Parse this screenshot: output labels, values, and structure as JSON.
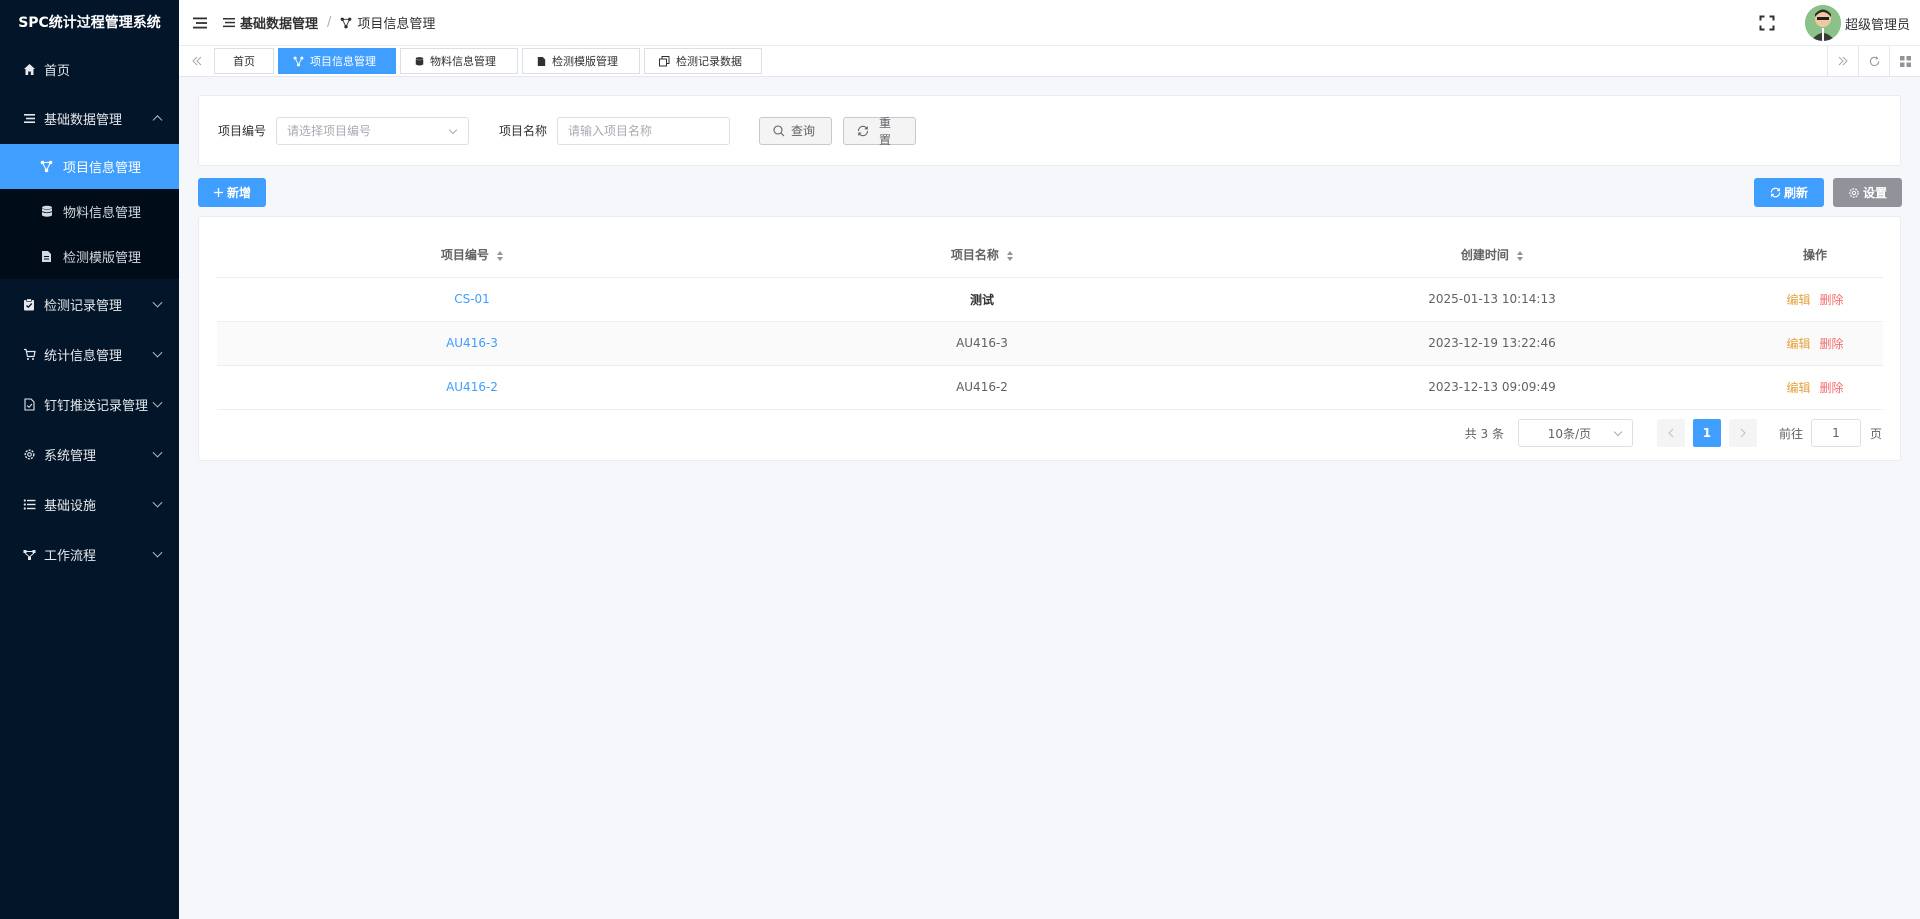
{
  "app": {
    "title": "SPC统计过程管理系统"
  },
  "sidebar": {
    "items": [
      {
        "label": "首页",
        "icon": "home-icon"
      },
      {
        "label": "基础数据管理",
        "icon": "list-icon",
        "expanded": true,
        "children": [
          {
            "label": "项目信息管理",
            "icon": "network-icon",
            "active": true
          },
          {
            "label": "物料信息管理",
            "icon": "database-icon"
          },
          {
            "label": "检测模版管理",
            "icon": "document-icon"
          }
        ]
      },
      {
        "label": "检测记录管理",
        "icon": "clipboard-icon"
      },
      {
        "label": "统计信息管理",
        "icon": "cart-icon"
      },
      {
        "label": "钉钉推送记录管理",
        "icon": "file-icon"
      },
      {
        "label": "系统管理",
        "icon": "gear-icon"
      },
      {
        "label": "基础设施",
        "icon": "list-bullet-icon"
      },
      {
        "label": "工作流程",
        "icon": "flow-icon"
      }
    ]
  },
  "header": {
    "breadcrumb": [
      "基础数据管理",
      "项目信息管理"
    ],
    "username": "超级管理员"
  },
  "tabs": [
    {
      "label": "首页"
    },
    {
      "label": "项目信息管理",
      "active": true
    },
    {
      "label": "物料信息管理"
    },
    {
      "label": "检测模版管理"
    },
    {
      "label": "检测记录数据"
    }
  ],
  "search": {
    "code_label": "项目编号",
    "code_placeholder": "请选择项目编号",
    "name_label": "项目名称",
    "name_placeholder": "请输入项目名称",
    "query_label": "查询",
    "reset_label": "重置"
  },
  "toolbar": {
    "add_label": "新增",
    "refresh_label": "刷新",
    "settings_label": "设置"
  },
  "table": {
    "columns": [
      "项目编号",
      "项目名称",
      "创建时间",
      "操作"
    ],
    "rows": [
      {
        "code": "CS-01",
        "name": "测试",
        "created": "2025-01-13 10:14:13"
      },
      {
        "code": "AU416-3",
        "name": "AU416-3",
        "created": "2023-12-19 13:22:46"
      },
      {
        "code": "AU416-2",
        "name": "AU416-2",
        "created": "2023-12-13 09:09:49"
      }
    ],
    "edit_label": "编辑",
    "delete_label": "删除"
  },
  "pagination": {
    "total_text": "共 3 条",
    "page_size": "10条/页",
    "current_page": "1",
    "goto_label": "前往",
    "goto_value": "1",
    "page_suffix": "页"
  },
  "colors": {
    "sidebar_bg": "#021529",
    "primary": "#409eff",
    "warning": "#e6a23c",
    "danger": "#f56c6c",
    "info": "#909399"
  }
}
